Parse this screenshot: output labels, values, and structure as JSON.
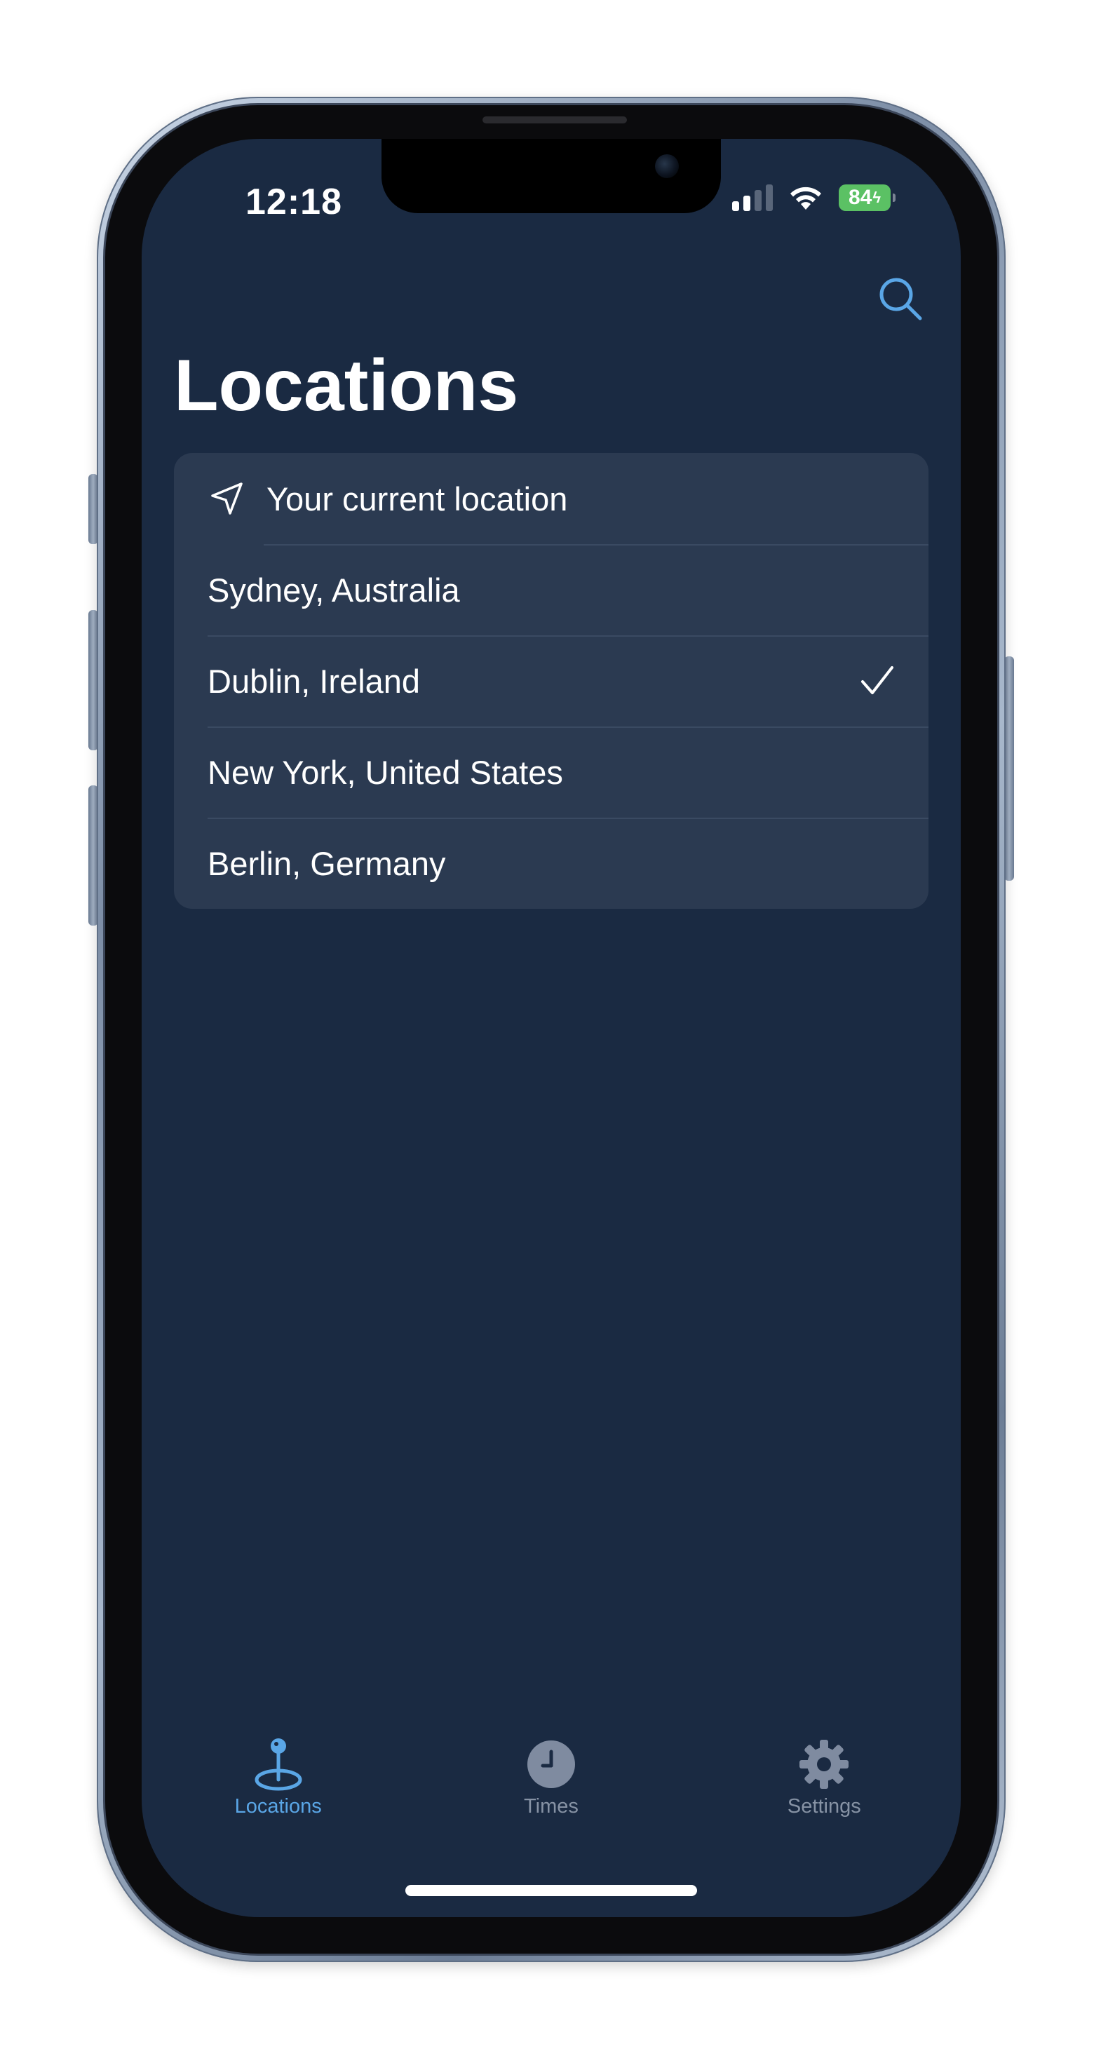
{
  "status_bar": {
    "time": "12:18",
    "battery": "84",
    "signal_icon": "cellular-signal-icon",
    "wifi_icon": "wifi-icon"
  },
  "header": {
    "title": "Locations",
    "search_icon": "search-icon"
  },
  "locations": {
    "current_location": {
      "label": "Your current location",
      "icon": "location-arrow-icon"
    },
    "items": [
      {
        "label": "Sydney, Australia",
        "selected": false
      },
      {
        "label": "Dublin, Ireland",
        "selected": true
      },
      {
        "label": "New York, United States",
        "selected": false
      },
      {
        "label": "Berlin, Germany",
        "selected": false
      }
    ],
    "selected_icon": "checkmark-icon"
  },
  "tab_bar": {
    "tabs": [
      {
        "label": "Locations",
        "icon": "map-pin-icon",
        "active": true
      },
      {
        "label": "Times",
        "icon": "clock-icon",
        "active": false
      },
      {
        "label": "Settings",
        "icon": "gear-icon",
        "active": false
      }
    ]
  },
  "colors": {
    "background": "#1a2a42",
    "card": "#2b3a51",
    "accent": "#5aa6e6",
    "inactive": "#8692a4",
    "battery": "#5bc164"
  }
}
